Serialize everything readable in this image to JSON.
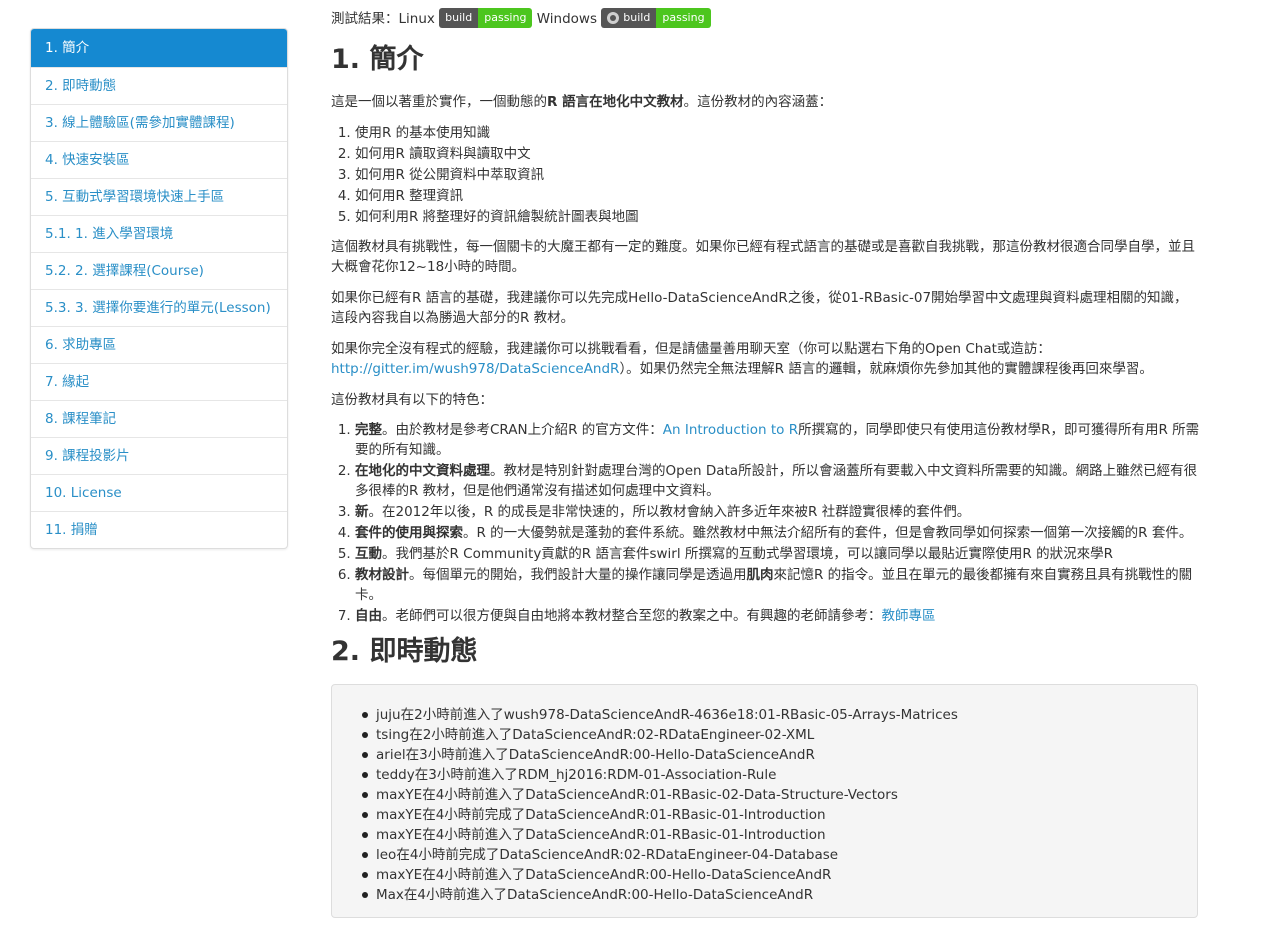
{
  "sidebar": {
    "items": [
      {
        "label": "1. 簡介",
        "active": true
      },
      {
        "label": "2. 即時動態"
      },
      {
        "label": "3. 線上體驗區(需參加實體課程)"
      },
      {
        "label": "4. 快速安裝區"
      },
      {
        "label": "5. 互動式學習環境快速上手區"
      },
      {
        "label": "5.1. 1. 進入學習環境"
      },
      {
        "label": "5.2. 2. 選擇課程(Course)"
      },
      {
        "label": "5.3. 3. 選擇你要進行的單元(Lesson)"
      },
      {
        "label": "6. 求助專區"
      },
      {
        "label": "7. 緣起"
      },
      {
        "label": "8. 課程筆記"
      },
      {
        "label": "9. 課程投影片"
      },
      {
        "label": "10. License"
      },
      {
        "label": "11. 捐贈"
      }
    ]
  },
  "status": {
    "prefix": "測試結果：Linux",
    "windows_label": "Windows",
    "badge_linux": {
      "left": "build",
      "right": "passing"
    },
    "badge_windows": {
      "left": "build",
      "right": "passing"
    }
  },
  "intro": {
    "heading": "1. 簡介",
    "p1_a": "這是一個以著重於實作，一個動態的",
    "p1_b": "R 語言在地化中文教材",
    "p1_c": "。這份教材的內容涵蓋：",
    "topics": [
      "使用R 的基本使用知識",
      "如何用R 讀取資料與讀取中文",
      "如何用R 從公開資料中萃取資訊",
      "如何用R 整理資訊",
      "如何利用R 將整理好的資訊繪製統計圖表與地圖"
    ],
    "p2": "這個教材具有挑戰性，每一個關卡的大魔王都有一定的難度。如果你已經有程式語言的基礎或是喜歡自我挑戰，那這份教材很適合同學自學，並且大概會花你12~18小時的時間。",
    "p3": "如果你已經有R 語言的基礎，我建議你可以先完成Hello-DataScienceAndR之後，從01-RBasic-07開始學習中文處理與資料處理相關的知識，這段內容我自以為勝過大部分的R 教材。",
    "p4_a": "如果你完全沒有程式的經驗，我建議你可以挑戰看看，但是請儘量善用聊天室（你可以點選右下角的Open Chat或造訪：",
    "p4_link": "http://gitter.im/wush978/DataScienceAndR",
    "p4_b": "）。如果仍然完全無法理解R 語言的邏輯，就麻煩你先參加其他的實體課程後再回來學習。",
    "p5": "這份教材具有以下的特色：",
    "features": [
      {
        "bold": "完整",
        "text_a": "。由於教材是參考CRAN上介紹R 的官方文件：",
        "link": "An Introduction to R",
        "text_b": "所撰寫的，同學即使只有使用這份教材學R，即可獲得所有用R 所需要的所有知識。"
      },
      {
        "bold": "在地化的中文資料處理",
        "text_a": "。教材是特別針對處理台灣的Open Data所設計，所以會涵蓋所有要載入中文資料所需要的知識。網路上雖然已經有很多很棒的R 教材，但是他們通常沒有描述如何處理中文資料。"
      },
      {
        "bold": "新",
        "text_a": "。在2012年以後，R 的成長是非常快速的，所以教材會納入許多近年來被R 社群證實很棒的套件們。"
      },
      {
        "bold": "套件的使用與探索",
        "text_a": "。R 的一大優勢就是蓬勃的套件系統。雖然教材中無法介紹所有的套件，但是會教同學如何探索一個第一次接觸的R 套件。"
      },
      {
        "bold": "互動",
        "text_a": "。我們基於R Community貢獻的R 語言套件swirl 所撰寫的互動式學習環境，可以讓同學以最貼近實際使用R 的狀況來學R"
      },
      {
        "bold": "教材設計",
        "text_a": "。每個單元的開始，我們設計大量的操作讓同學是透過用",
        "bold2": "肌肉",
        "text_b": "來記憶R 的指令。並且在單元的最後都擁有來自實務且具有挑戰性的關卡。"
      },
      {
        "bold": "自由",
        "text_a": "。老師們可以很方便與自由地將本教材整合至您的教案之中。有興趣的老師請參考：",
        "link": "教師專區"
      }
    ]
  },
  "live": {
    "heading": "2. 即時動態",
    "entries": [
      "juju在2小時前進入了wush978-DataScienceAndR-4636e18:01-RBasic-05-Arrays-Matrices",
      "tsing在2小時前進入了DataScienceAndR:02-RDataEngineer-02-XML",
      "ariel在3小時前進入了DataScienceAndR:00-Hello-DataScienceAndR",
      "teddy在3小時前進入了RDM_hj2016:RDM-01-Association-Rule",
      "maxYE在4小時前進入了DataScienceAndR:01-RBasic-02-Data-Structure-Vectors",
      "maxYE在4小時前完成了DataScienceAndR:01-RBasic-01-Introduction",
      "maxYE在4小時前進入了DataScienceAndR:01-RBasic-01-Introduction",
      "leo在4小時前完成了DataScienceAndR:02-RDataEngineer-04-Database",
      "maxYE在4小時前進入了DataScienceAndR:00-Hello-DataScienceAndR",
      "Max在4小時前進入了DataScienceAndR:00-Hello-DataScienceAndR"
    ]
  }
}
